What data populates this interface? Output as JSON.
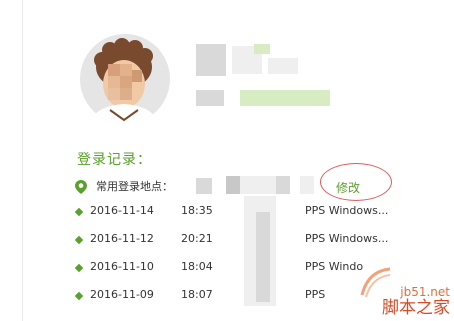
{
  "profile": {
    "avatar_icon": "user-avatar-icon"
  },
  "login_history": {
    "title": "登录记录：",
    "common_location_label": "常用登录地点：",
    "edit_label": "修改",
    "accent_color": "#5aa02c",
    "highlight_color": "#e05a5a",
    "records": [
      {
        "date": "2016-11-14",
        "time": "18:35",
        "device": "PPS Windows..."
      },
      {
        "date": "2016-11-12",
        "time": "20:21",
        "device": "PPS Windows..."
      },
      {
        "date": "2016-11-10",
        "time": "18:04",
        "device": "PPS Windo"
      },
      {
        "date": "2016-11-09",
        "time": "18:07",
        "device": "PPS"
      }
    ]
  },
  "watermark": {
    "site": "jb51.net",
    "name": "脚本之家"
  }
}
